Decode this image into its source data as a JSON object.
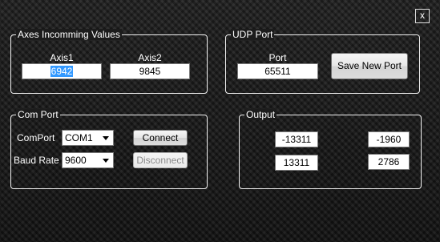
{
  "window": {
    "close_label": "x"
  },
  "axes": {
    "title": "Axes Incomming Values",
    "axis1_label": "Axis1",
    "axis2_label": "Axis2",
    "axis1_value": "6942",
    "axis2_value": "9845"
  },
  "udp": {
    "title": "UDP Port",
    "port_label": "Port",
    "port_value": "65511",
    "save_button": "Save New Port"
  },
  "com": {
    "title": "Com Port",
    "comport_label": "ComPort",
    "comport_value": "COM1",
    "baud_label": "Baud Rate",
    "baud_value": "9600",
    "connect_button": "Connect",
    "disconnect_button": "Disconnect"
  },
  "output": {
    "title": "Output",
    "values": [
      "-13311",
      "-1960",
      "13311",
      "2786"
    ]
  }
}
